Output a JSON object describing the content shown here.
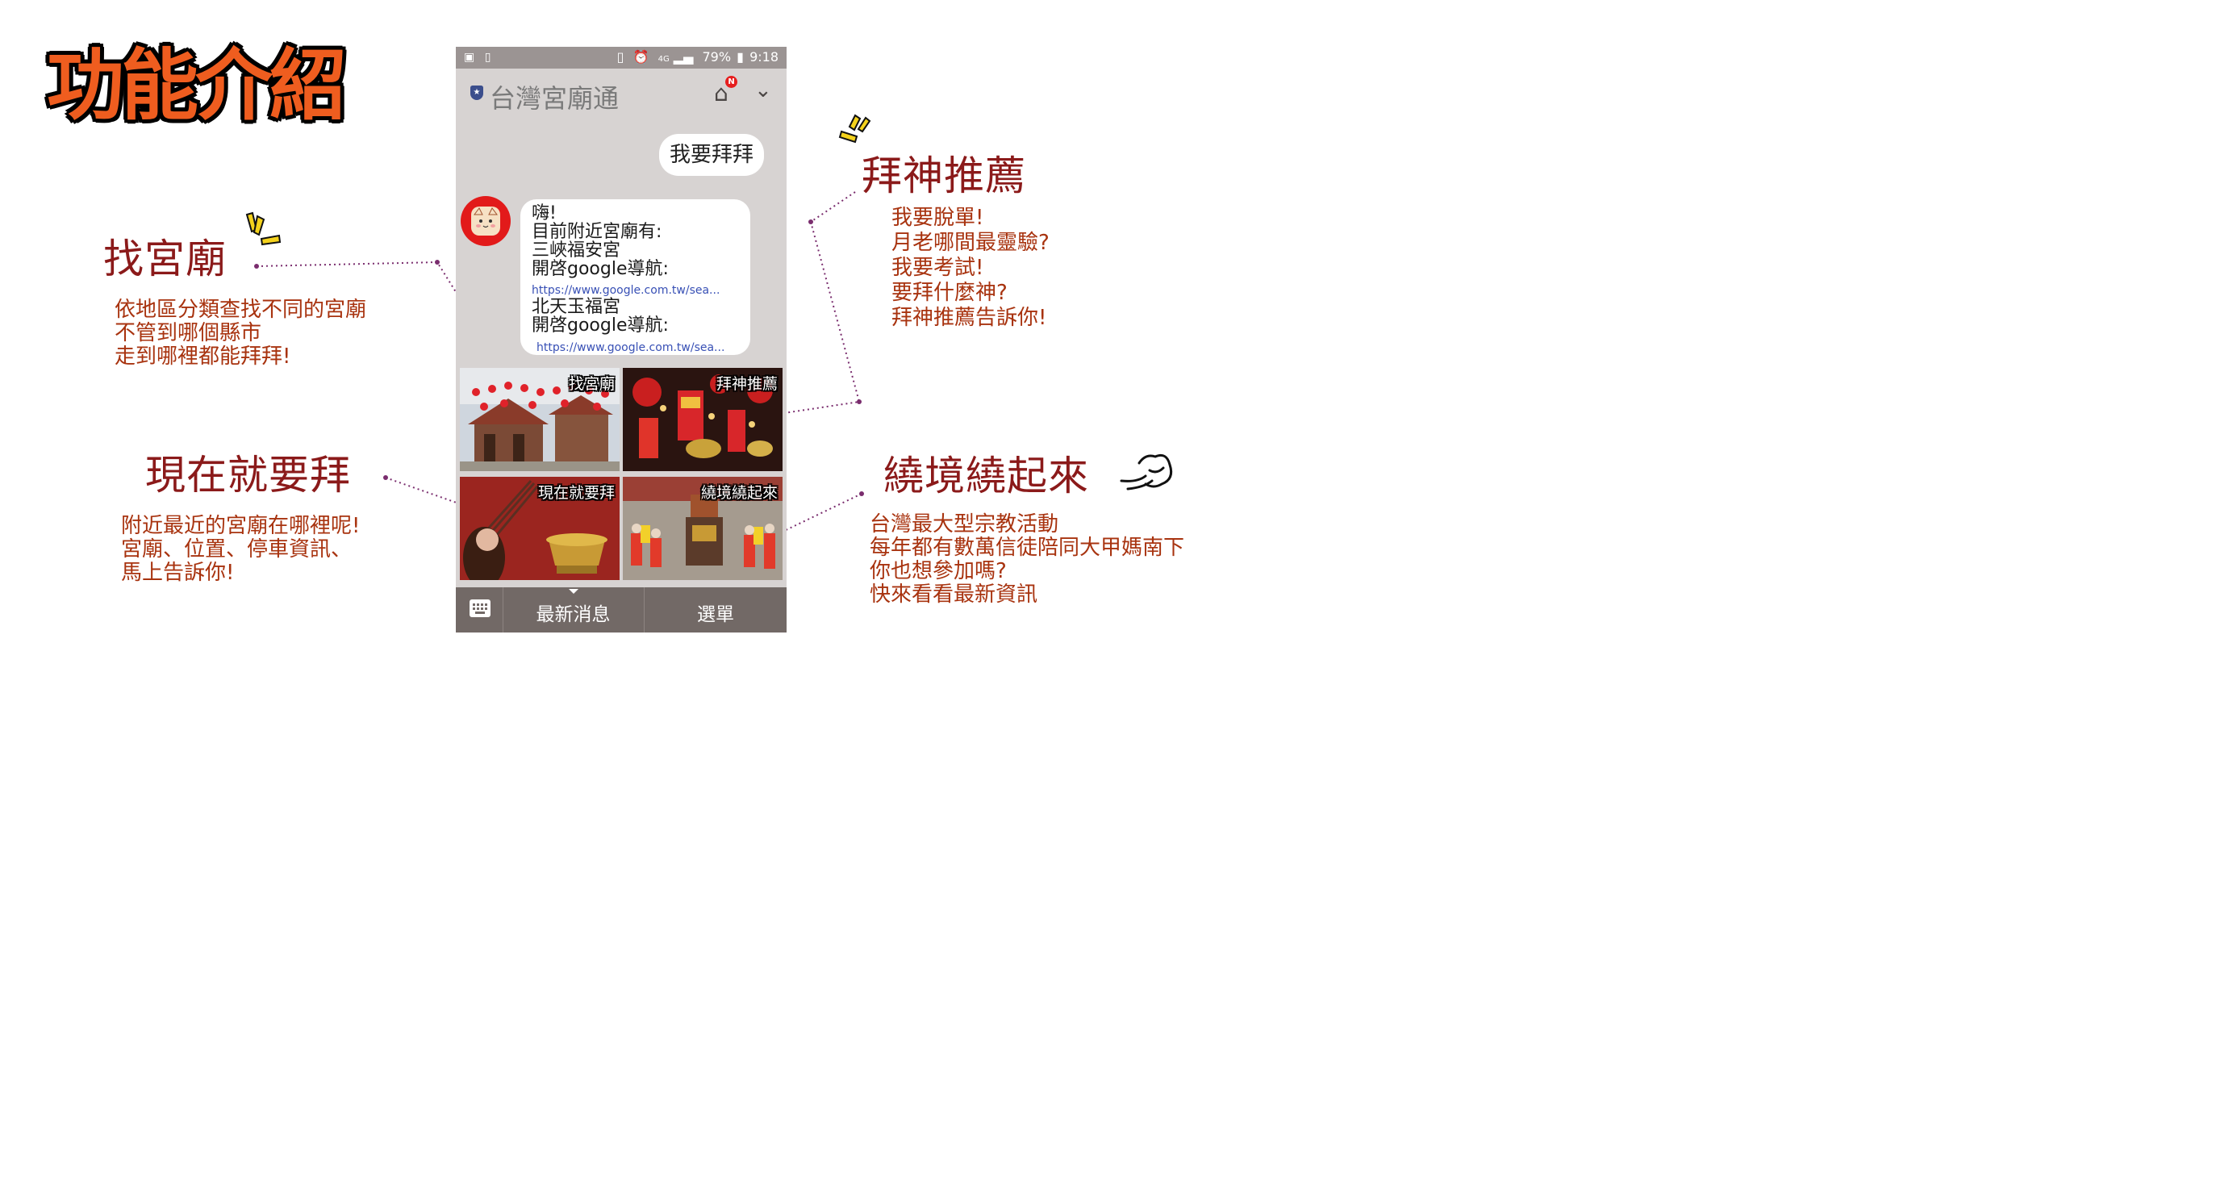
{
  "page_title": "功能介紹",
  "features": {
    "find_temple": {
      "title": "找宮廟",
      "lines": [
        "依地區分類查找不同的宮廟",
        "不管到哪個縣市",
        "走到哪裡都能拜拜!"
      ]
    },
    "worship_now": {
      "title": "現在就要拜",
      "lines": [
        "附近最近的宮廟在哪裡呢!",
        "宮廟、位置、停車資訊、",
        "馬上告訴你!"
      ]
    },
    "worship_recommend": {
      "title": "拜神推薦",
      "lines": [
        "我要脫單!",
        "月老哪間最靈驗?",
        "我要考試!",
        "要拜什麼神?",
        "拜神推薦告訴你!"
      ]
    },
    "pilgrimage": {
      "title": "繞境繞起來",
      "lines": [
        "台灣最大型宗教活動",
        "每年都有數萬信徒陪同大甲媽南下",
        "你也想參加嗎?",
        "快來看看最新資訊"
      ]
    }
  },
  "phone": {
    "status_bar": {
      "battery": "79%",
      "time": "9:18",
      "network": "4G"
    },
    "app_title": "台灣宮廟通",
    "notification_badge": "N",
    "user_message": "我要拜拜",
    "bot_message": {
      "greeting": "嗨!",
      "intro": "目前附近宮廟有:",
      "temples": [
        {
          "name": "三峽福安宮",
          "nav_label": "開啓google導航:",
          "link": "https://www.google.com.tw/sea..."
        },
        {
          "name": "北天玉福宮",
          "nav_label": "開啓google導航:",
          "link": "https://www.google.com.tw/sea..."
        }
      ]
    },
    "menu_tiles": [
      "找宮廟",
      "拜神推薦",
      "現在就要拜",
      "繞境繞起來"
    ],
    "bottom_bar": {
      "news_label": "最新消息",
      "menu_label": "選單"
    }
  },
  "colors": {
    "title_orange": "#ef5d1f",
    "feature_title": "#8b1a1a",
    "feature_text": "#a8330f",
    "phone_bg": "#d7d3d2",
    "bottom_bar": "#726966",
    "link_blue": "#3850b5",
    "avatar_red": "#e21a1a"
  }
}
